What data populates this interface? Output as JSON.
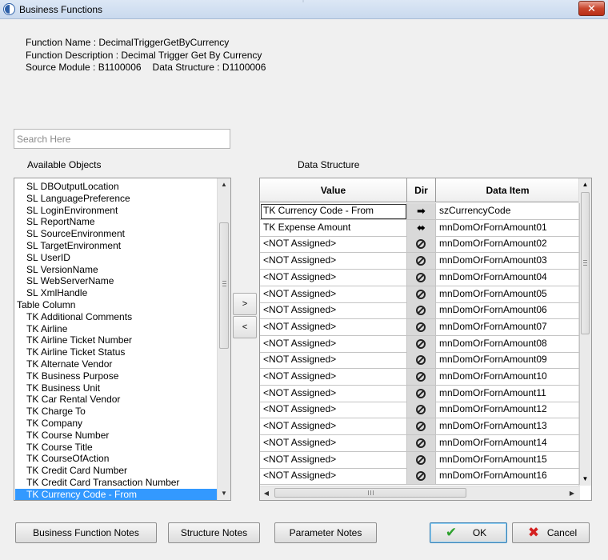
{
  "window": {
    "title": "Business Functions",
    "close_glyph": "✕"
  },
  "info": {
    "function_name": "Function Name : DecimalTriggerGetByCurrency",
    "function_description": "Function Description : Decimal Trigger Get By Currency",
    "source_module": "Source Module : B1100006",
    "data_structure": "Data Structure : D1100006"
  },
  "search": {
    "placeholder": "Search Here",
    "value": ""
  },
  "labels": {
    "available_objects": "Available Objects",
    "data_structure": "Data Structure"
  },
  "available_objects": [
    {
      "prefix": "SL",
      "name": "DBOutputLocation",
      "type": "child"
    },
    {
      "prefix": "SL",
      "name": "LanguagePreference",
      "type": "child"
    },
    {
      "prefix": "SL",
      "name": "LoginEnvironment",
      "type": "child"
    },
    {
      "prefix": "SL",
      "name": "ReportName",
      "type": "child"
    },
    {
      "prefix": "SL",
      "name": "SourceEnvironment",
      "type": "child"
    },
    {
      "prefix": "SL",
      "name": "TargetEnvironment",
      "type": "child"
    },
    {
      "prefix": "SL",
      "name": "UserID",
      "type": "child"
    },
    {
      "prefix": "SL",
      "name": "VersionName",
      "type": "child"
    },
    {
      "prefix": "SL",
      "name": "WebServerName",
      "type": "child"
    },
    {
      "prefix": "SL",
      "name": "XmlHandle",
      "type": "child"
    },
    {
      "prefix": "",
      "name": "Table Column",
      "type": "group"
    },
    {
      "prefix": "TK",
      "name": "Additional Comments",
      "type": "child"
    },
    {
      "prefix": "TK",
      "name": "Airline",
      "type": "child"
    },
    {
      "prefix": "TK",
      "name": "Airline Ticket Number",
      "type": "child"
    },
    {
      "prefix": "TK",
      "name": "Airline Ticket Status",
      "type": "child"
    },
    {
      "prefix": "TK",
      "name": "Alternate Vendor",
      "type": "child"
    },
    {
      "prefix": "TK",
      "name": "Business Purpose",
      "type": "child"
    },
    {
      "prefix": "TK",
      "name": "Business Unit",
      "type": "child"
    },
    {
      "prefix": "TK",
      "name": "Car Rental Vendor",
      "type": "child"
    },
    {
      "prefix": "TK",
      "name": "Charge To",
      "type": "child"
    },
    {
      "prefix": "TK",
      "name": "Company",
      "type": "child"
    },
    {
      "prefix": "TK",
      "name": "Course Number",
      "type": "child"
    },
    {
      "prefix": "TK",
      "name": "Course Title",
      "type": "child"
    },
    {
      "prefix": "TK",
      "name": "CourseOfAction",
      "type": "child"
    },
    {
      "prefix": "TK",
      "name": "Credit Card Number",
      "type": "child"
    },
    {
      "prefix": "TK",
      "name": "Credit Card Transaction Number",
      "type": "child"
    },
    {
      "prefix": "TK",
      "name": "Currency Code - From",
      "type": "child",
      "selected": true
    }
  ],
  "move_buttons": {
    "add": ">",
    "remove": "<"
  },
  "grid": {
    "columns": [
      "Value",
      "Dir",
      "Data Item"
    ],
    "rows": [
      {
        "value": "TK Currency Code - From",
        "dir": "in",
        "item": "szCurrencyCode"
      },
      {
        "value": "TK Expense Amount",
        "dir": "both",
        "item": "mnDomOrFornAmount01"
      },
      {
        "value": "<NOT Assigned>",
        "dir": "none",
        "item": "mnDomOrFornAmount02"
      },
      {
        "value": "<NOT Assigned>",
        "dir": "none",
        "item": "mnDomOrFornAmount03"
      },
      {
        "value": "<NOT Assigned>",
        "dir": "none",
        "item": "mnDomOrFornAmount04"
      },
      {
        "value": "<NOT Assigned>",
        "dir": "none",
        "item": "mnDomOrFornAmount05"
      },
      {
        "value": "<NOT Assigned>",
        "dir": "none",
        "item": "mnDomOrFornAmount06"
      },
      {
        "value": "<NOT Assigned>",
        "dir": "none",
        "item": "mnDomOrFornAmount07"
      },
      {
        "value": "<NOT Assigned>",
        "dir": "none",
        "item": "mnDomOrFornAmount08"
      },
      {
        "value": "<NOT Assigned>",
        "dir": "none",
        "item": "mnDomOrFornAmount09"
      },
      {
        "value": "<NOT Assigned>",
        "dir": "none",
        "item": "mnDomOrFornAmount10"
      },
      {
        "value": "<NOT Assigned>",
        "dir": "none",
        "item": "mnDomOrFornAmount11"
      },
      {
        "value": "<NOT Assigned>",
        "dir": "none",
        "item": "mnDomOrFornAmount12"
      },
      {
        "value": "<NOT Assigned>",
        "dir": "none",
        "item": "mnDomOrFornAmount13"
      },
      {
        "value": "<NOT Assigned>",
        "dir": "none",
        "item": "mnDomOrFornAmount14"
      },
      {
        "value": "<NOT Assigned>",
        "dir": "none",
        "item": "mnDomOrFornAmount15"
      },
      {
        "value": "<NOT Assigned>",
        "dir": "none",
        "item": "mnDomOrFornAmount16"
      }
    ]
  },
  "buttons": {
    "function_notes": "Business Function Notes",
    "structure_notes": "Structure Notes",
    "parameter_notes": "Parameter Notes",
    "ok": "OK",
    "cancel": "Cancel"
  },
  "icons": {
    "ok": "checkmark-icon",
    "cancel": "x-icon",
    "dir_in": "right-arrow-icon",
    "dir_both": "double-arrow-icon",
    "dir_none": "no-entry-icon"
  },
  "colors": {
    "selection": "#3399ff",
    "ok_check": "#2ea12e",
    "cancel_x": "#d42020",
    "close_button": "#c9462d"
  }
}
